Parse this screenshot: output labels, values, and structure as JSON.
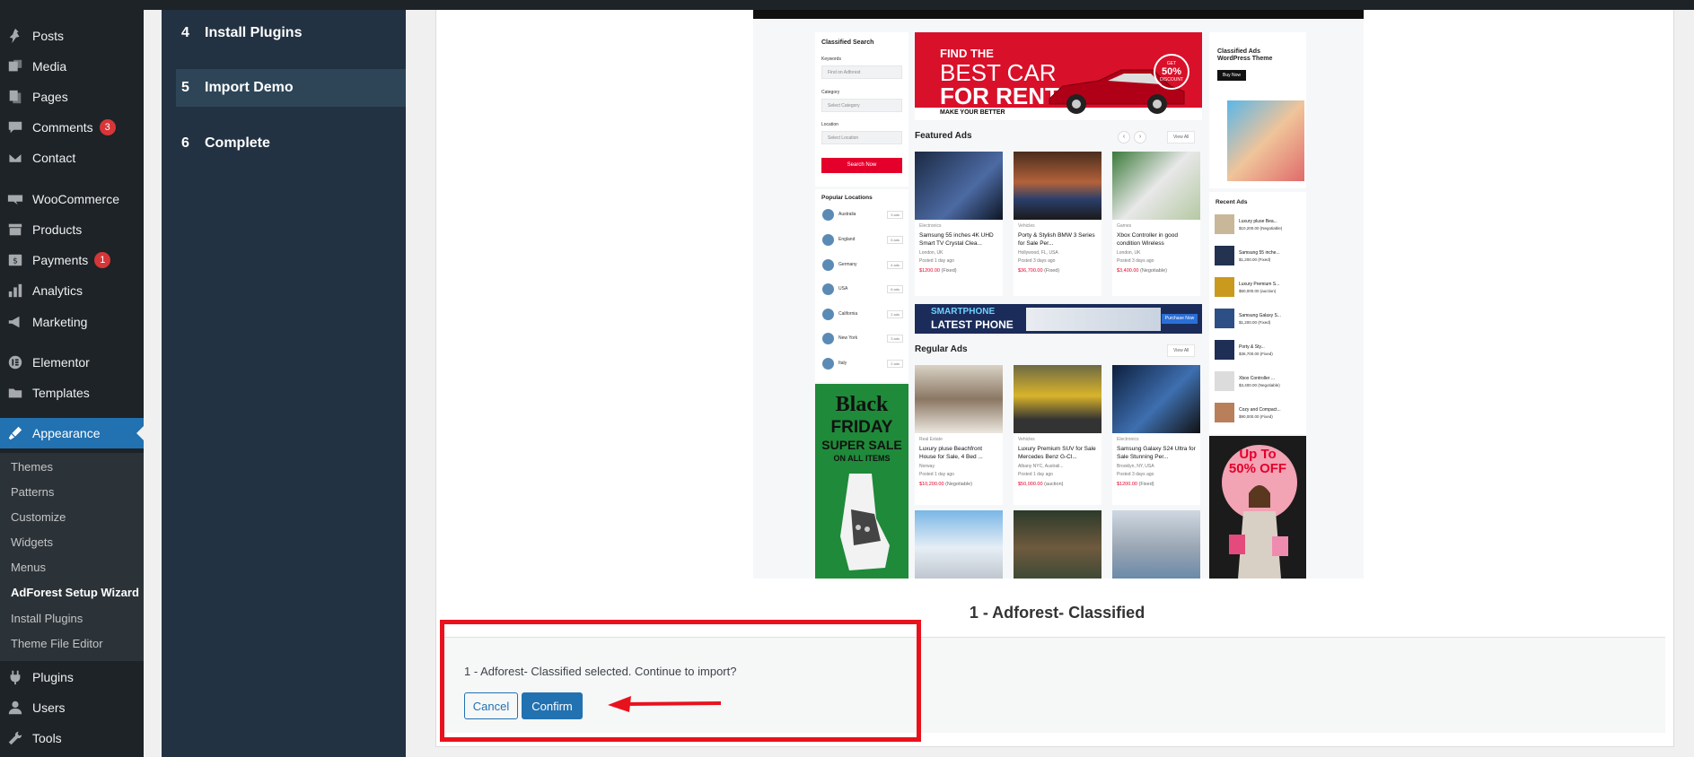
{
  "admin_menu": {
    "items": [
      {
        "label": "Posts",
        "icon": "pin-icon"
      },
      {
        "label": "Media",
        "icon": "media-icon"
      },
      {
        "label": "Pages",
        "icon": "pages-icon"
      },
      {
        "label": "Comments",
        "icon": "comment-icon",
        "badge": "3"
      },
      {
        "label": "Contact",
        "icon": "mail-icon"
      },
      {
        "label": "WooCommerce",
        "icon": "woo-icon"
      },
      {
        "label": "Products",
        "icon": "archive-icon"
      },
      {
        "label": "Payments",
        "icon": "dollar-icon",
        "badge": "1"
      },
      {
        "label": "Analytics",
        "icon": "chart-icon"
      },
      {
        "label": "Marketing",
        "icon": "megaphone-icon"
      },
      {
        "label": "Elementor",
        "icon": "elementor-icon"
      },
      {
        "label": "Templates",
        "icon": "folder-icon"
      },
      {
        "label": "Appearance",
        "icon": "brush-icon"
      },
      {
        "label": "Plugins",
        "icon": "plugin-icon"
      },
      {
        "label": "Users",
        "icon": "user-icon"
      },
      {
        "label": "Tools",
        "icon": "wrench-icon"
      }
    ],
    "appearance_submenu": [
      "Themes",
      "Patterns",
      "Customize",
      "Widgets",
      "Menus",
      "AdForest Setup Wizard",
      "Install Plugins",
      "Theme File Editor"
    ]
  },
  "wizard": {
    "steps": [
      {
        "num": "4",
        "label": "Install Plugins"
      },
      {
        "num": "5",
        "label": "Import Demo"
      },
      {
        "num": "6",
        "label": "Complete"
      }
    ]
  },
  "demo_preview": {
    "search": {
      "title": "Classified Search",
      "keywords_label": "Keywords",
      "keywords_placeholder": "Find on Adforest",
      "category_label": "Category",
      "category_value": "Select Category",
      "location_label": "Location",
      "location_value": "Select Location",
      "button": "Search Now"
    },
    "popular_locations": {
      "title": "Popular Locations",
      "items": [
        {
          "name": "Australia",
          "count": "3 ads"
        },
        {
          "name": "England",
          "count": "5 ads"
        },
        {
          "name": "Germany",
          "count": "4 ads"
        },
        {
          "name": "USA",
          "count": "6 ads"
        },
        {
          "name": "California",
          "count": "2 ads"
        },
        {
          "name": "New York",
          "count": "3 ads"
        },
        {
          "name": "Italy",
          "count": "2 ads"
        }
      ]
    },
    "hero": {
      "line1": "FIND THE",
      "line2": "BEST CAR",
      "line3": "FOR RENT",
      "tag": "MAKE YOUR BETTER",
      "discount_a": "GET",
      "discount_b": "50%",
      "discount_c": "DISCOUNT"
    },
    "featured": {
      "title": "Featured Ads",
      "view_all": "View All",
      "ads": [
        {
          "cat": "Electronics",
          "title": "Samsung 55 inches 4K UHD Smart TV Crystal Clea...",
          "loc": "London, UK",
          "time": "Posted 1 day ago",
          "price": "$1200.00",
          "price_type": "(Fixed)"
        },
        {
          "cat": "Vehicles",
          "title": "Porty & Stylish BMW 3 Series for Sale Per...",
          "loc": "Hollywood, FL, USA",
          "time": "Posted 3 days ago",
          "price": "$36,700.00",
          "price_type": "(Fixed)"
        },
        {
          "cat": "Games",
          "title": "Xbox Controller in good condition Wireless",
          "loc": "London, UK",
          "time": "Posted 3 days ago",
          "price": "$3,400.00",
          "price_type": "(Negotiable)"
        }
      ]
    },
    "banner": {
      "line1": "SMARTPHONE",
      "line2": "LATEST PHONE",
      "button": "Purchase Now"
    },
    "regular": {
      "title": "Regular Ads",
      "view_all": "View All",
      "ads": [
        {
          "cat": "Real Estate",
          "title": "Luxury pluse Beachfront House for Sale, 4 Bed ...",
          "loc": "Norway",
          "time": "Posted 1 day ago",
          "price": "$10,200.00",
          "price_type": "(Negotiable)"
        },
        {
          "cat": "Vehicles",
          "title": "Luxury Premium SUV for Sale Mercedes Benz G-Cl...",
          "loc": "Albany NYC, Australi...",
          "time": "Posted 1 day ago",
          "price": "$50,000.00",
          "price_type": "(auction)"
        },
        {
          "cat": "Electronics",
          "title": "Samsung Galaxy S24 Ultra for Sale Stunning Per...",
          "loc": "Brooklyn, NY, USA",
          "time": "Posted 3 days ago",
          "price": "$1200.00",
          "price_type": "(Fixed)"
        }
      ]
    },
    "promo_left": {
      "line1": "Black",
      "line2": "FRIDAY",
      "line3": "SUPER SALE",
      "line4": "ON ALL ITEMS"
    },
    "promo_right": {
      "title": "Classified Ads WordPress Theme",
      "button": "Buy Now"
    },
    "promo_sale": {
      "line1": "Up To",
      "line2": "50% OFF"
    },
    "recent": {
      "title": "Recent Ads",
      "items": [
        {
          "title": "Luxury pluse Bea...",
          "price": "$10,200.00",
          "type": "(Negotiable)"
        },
        {
          "title": "Samsung 55 inche...",
          "price": "$1,200.00",
          "type": "(Fixed)"
        },
        {
          "title": "Luxury Premium S...",
          "price": "$50,000.00",
          "type": "(auction)"
        },
        {
          "title": "Samsung Galaxy S...",
          "price": "$1,200.00",
          "type": "(Fixed)"
        },
        {
          "title": "Porty & Sty...",
          "price": "$36,700.00",
          "type": "(Fixed)"
        },
        {
          "title": "Xbox Controller ...",
          "price": "$3,400.00",
          "type": "(Negotiable)"
        },
        {
          "title": "Cozy and Compact...",
          "price": "$90,000.00",
          "type": "(Fixed)"
        }
      ]
    }
  },
  "demo_caption": "1 - Adforest- Classified",
  "confirm": {
    "message": "1 - Adforest- Classified selected. Continue to import?",
    "cancel": "Cancel",
    "confirm": "Confirm"
  },
  "colors": {
    "accent": "#2271b1",
    "sidebar": "#1d2327",
    "wizard_panel": "#233242",
    "highlight": "#e8121d",
    "brand_red": "#e4002b"
  }
}
